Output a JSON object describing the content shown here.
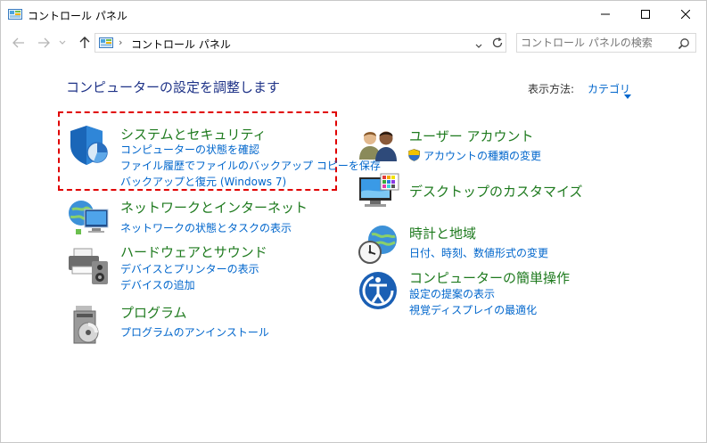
{
  "window": {
    "title": "コントロール パネル"
  },
  "address": {
    "path": "コントロール パネル",
    "search_placeholder": "コントロール パネルの検索"
  },
  "content": {
    "heading": "コンピューターの設定を調整します",
    "view_by_label": "表示方法:",
    "view_by_value": "カテゴリ"
  },
  "categories": {
    "system": {
      "title": "システムとセキュリティ",
      "links": [
        "コンピューターの状態を確認",
        "ファイル履歴でファイルのバックアップ コピーを保存",
        "バックアップと復元 (Windows 7)"
      ]
    },
    "network": {
      "title": "ネットワークとインターネット",
      "links": [
        "ネットワークの状態とタスクの表示"
      ]
    },
    "hardware": {
      "title": "ハードウェアとサウンド",
      "links": [
        "デバイスとプリンターの表示",
        "デバイスの追加"
      ]
    },
    "programs": {
      "title": "プログラム",
      "links": [
        "プログラムのアンインストール"
      ]
    },
    "users": {
      "title": "ユーザー アカウント",
      "links": [
        "アカウントの種類の変更"
      ]
    },
    "desktop": {
      "title": "デスクトップのカスタマイズ",
      "links": []
    },
    "clock": {
      "title": "時計と地域",
      "links": [
        "日付、時刻、数値形式の変更"
      ]
    },
    "ease": {
      "title": "コンピューターの簡単操作",
      "links": [
        "設定の提案の表示",
        "視覚ディスプレイの最適化"
      ]
    }
  },
  "colors": {
    "link": "#0066cc",
    "category_title": "#1e7a1e",
    "heading": "#1e3287",
    "highlight": "#e00000"
  }
}
